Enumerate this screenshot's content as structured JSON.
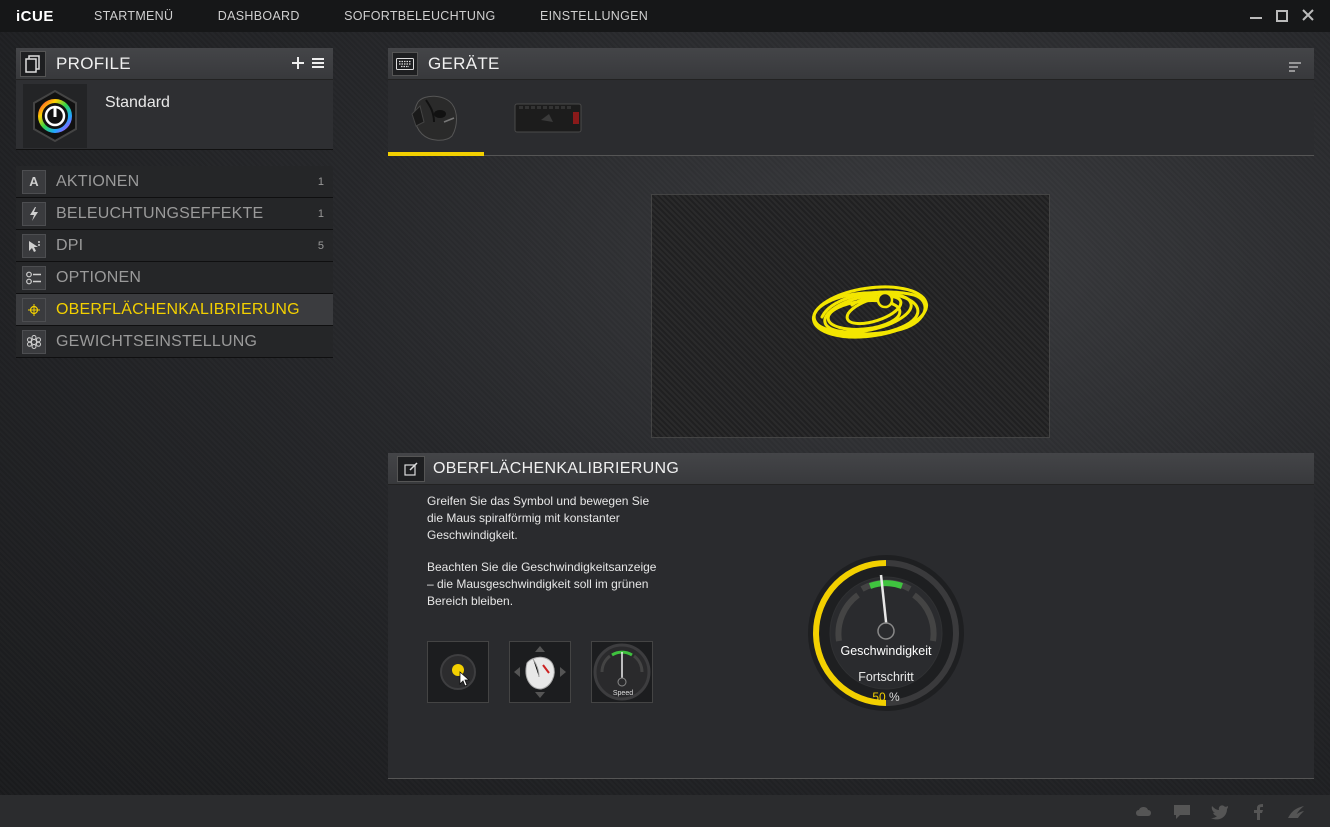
{
  "app": {
    "brand": "iCUE"
  },
  "nav": [
    "STARTMENÜ",
    "DASHBOARD",
    "SOFORTBELEUCHTUNG",
    "EINSTELLUNGEN"
  ],
  "profiles": {
    "title": "PROFILE",
    "current": "Standard"
  },
  "menu": [
    {
      "label": "AKTIONEN",
      "count": "1",
      "icon": "letter-a-icon"
    },
    {
      "label": "BELEUCHTUNGSEFFEKTE",
      "count": "1",
      "icon": "lightning-icon"
    },
    {
      "label": "DPI",
      "count": "5",
      "icon": "cursor-dpi-icon"
    },
    {
      "label": "OPTIONEN",
      "count": "",
      "icon": "options-icon"
    },
    {
      "label": "OBERFLÄCHENKALIBRIERUNG",
      "count": "",
      "icon": "target-icon",
      "active": true
    },
    {
      "label": "GEWICHTSEINSTELLUNG",
      "count": "",
      "icon": "weight-icon"
    }
  ],
  "devices": {
    "title": "GERÄTE"
  },
  "calibration": {
    "title": "OBERFLÄCHENKALIBRIERUNG",
    "instr1": "Greifen Sie das Symbol und bewegen Sie die Maus spiralförmig mit konstanter Geschwindigkeit.",
    "instr2": "Beachten Sie die Geschwindigkeitsanzeige – die Mausgeschwindigkeit soll im grünen Bereich bleiben.",
    "tile_speed_label": "Speed",
    "gauge_speed_label": "Geschwindigkeit",
    "gauge_progress_label": "Fortschritt",
    "progress_value": "50",
    "progress_unit": " %",
    "progress_fraction": 0.5
  },
  "colors": {
    "accent": "#f3d000",
    "green": "#3fc33f"
  }
}
